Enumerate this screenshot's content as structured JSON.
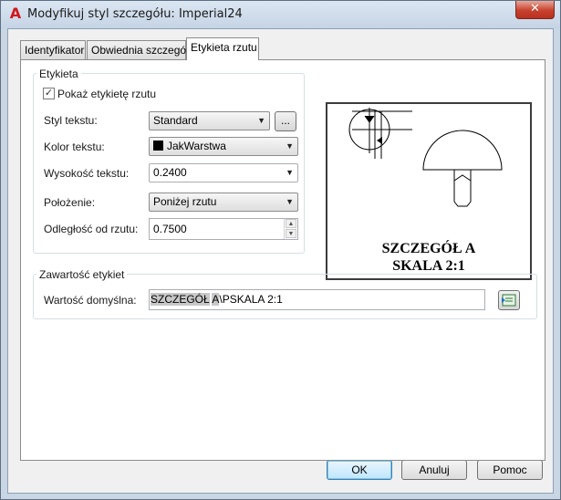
{
  "window": {
    "title": "Modyfikuj styl szczegółu: Imperial24",
    "close_glyph": "✕"
  },
  "tabs": [
    {
      "label": "Identyfikator"
    },
    {
      "label": "Obwiednia szczegółu"
    },
    {
      "label": "Etykieta rzutu"
    }
  ],
  "label_group": {
    "title": "Etykieta",
    "show_label": {
      "label": "Pokaż etykietę rzutu",
      "checked": true,
      "glyph": "✓"
    },
    "text_style": {
      "label": "Styl tekstu:",
      "value": "Standard",
      "browse_label": "..."
    },
    "text_color": {
      "label": "Kolor tekstu:",
      "value": "JakWarstwa",
      "swatch_color": "#000000"
    },
    "text_height": {
      "label": "Wysokość tekstu:",
      "value": "0.2400"
    },
    "position": {
      "label": "Położenie:",
      "value": "Poniżej rzutu"
    },
    "offset": {
      "label": "Odległość od rzutu:",
      "value": "0.7500"
    }
  },
  "preview": {
    "line1": "SZCZEGÓŁ A",
    "line2": "SKALA 2:1"
  },
  "contents_group": {
    "title": "Zawartość etykiet",
    "default_value_label": "Wartość domyślna:",
    "default_value_highlight1": "SZCZEGÓŁ",
    "default_value_space": " ",
    "default_value_highlight2": "A",
    "default_value_rest": "\\PSKALA 2:1",
    "insert_field_icon": "insert-field-icon"
  },
  "buttons": {
    "ok": "OK",
    "cancel": "Anuluj",
    "help": "Pomoc"
  },
  "colors": {
    "accent": "#3c7fb1",
    "close": "#c7412d"
  }
}
